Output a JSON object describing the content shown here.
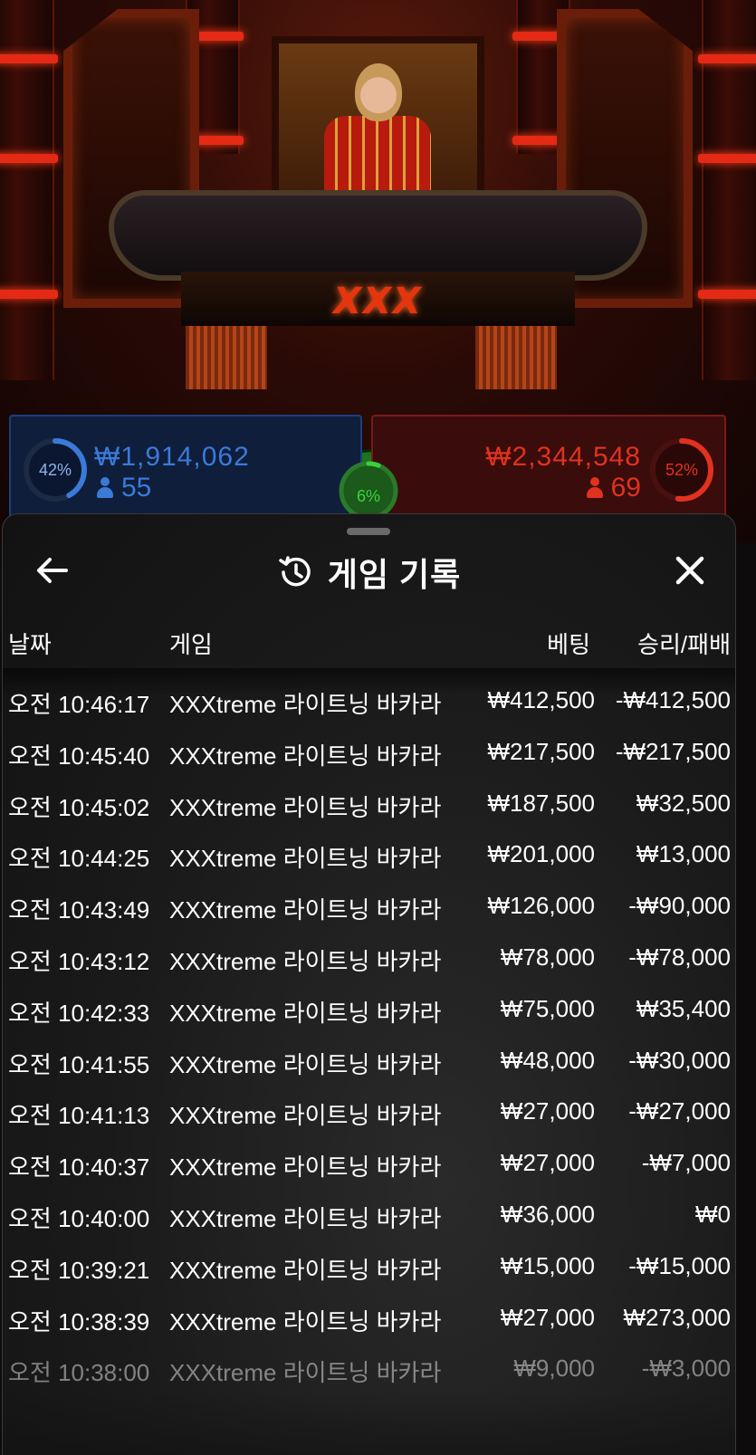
{
  "bets": {
    "player": {
      "amount": "₩1,914,062",
      "players": "55",
      "percent_label": "42%",
      "percent": 0.42,
      "color": "#3a7ad8"
    },
    "banker": {
      "amount": "₩2,344,548",
      "players": "69",
      "percent_label": "52%",
      "percent": 0.52,
      "color": "#e0321e"
    },
    "tie": {
      "percent_label": "6%",
      "percent": 0.06,
      "color": "#3ad23a"
    }
  },
  "history": {
    "title": "게임 기록",
    "columns": {
      "date": "날짜",
      "game": "게임",
      "bet": "베팅",
      "result": "승리/패배"
    },
    "rows": [
      {
        "time": "오전 10:46:17",
        "game": "XXXtreme 라이트닝 바카라",
        "bet": "₩412,500",
        "result": "-₩412,500"
      },
      {
        "time": "오전 10:45:40",
        "game": "XXXtreme 라이트닝 바카라",
        "bet": "₩217,500",
        "result": "-₩217,500"
      },
      {
        "time": "오전 10:45:02",
        "game": "XXXtreme 라이트닝 바카라",
        "bet": "₩187,500",
        "result": "₩32,500"
      },
      {
        "time": "오전 10:44:25",
        "game": "XXXtreme 라이트닝 바카라",
        "bet": "₩201,000",
        "result": "₩13,000"
      },
      {
        "time": "오전 10:43:49",
        "game": "XXXtreme 라이트닝 바카라",
        "bet": "₩126,000",
        "result": "-₩90,000"
      },
      {
        "time": "오전 10:43:12",
        "game": "XXXtreme 라이트닝 바카라",
        "bet": "₩78,000",
        "result": "-₩78,000"
      },
      {
        "time": "오전 10:42:33",
        "game": "XXXtreme 라이트닝 바카라",
        "bet": "₩75,000",
        "result": "₩35,400"
      },
      {
        "time": "오전 10:41:55",
        "game": "XXXtreme 라이트닝 바카라",
        "bet": "₩48,000",
        "result": "-₩30,000"
      },
      {
        "time": "오전 10:41:13",
        "game": "XXXtreme 라이트닝 바카라",
        "bet": "₩27,000",
        "result": "-₩27,000"
      },
      {
        "time": "오전 10:40:37",
        "game": "XXXtreme 라이트닝 바카라",
        "bet": "₩27,000",
        "result": "-₩7,000"
      },
      {
        "time": "오전 10:40:00",
        "game": "XXXtreme 라이트닝 바카라",
        "bet": "₩36,000",
        "result": "₩0"
      },
      {
        "time": "오전 10:39:21",
        "game": "XXXtreme 라이트닝 바카라",
        "bet": "₩15,000",
        "result": "-₩15,000"
      },
      {
        "time": "오전 10:38:39",
        "game": "XXXtreme 라이트닝 바카라",
        "bet": "₩27,000",
        "result": "₩273,000"
      },
      {
        "time": "오전 10:38:00",
        "game": "XXXtreme 라이트닝 바카라",
        "bet": "₩9,000",
        "result": "-₩3,000"
      }
    ]
  },
  "scene": {
    "logo_text": "XXX"
  },
  "icons": {
    "back": "arrow-left-icon",
    "history": "history-clock-icon",
    "close": "close-x-icon",
    "players": "person-icon"
  }
}
